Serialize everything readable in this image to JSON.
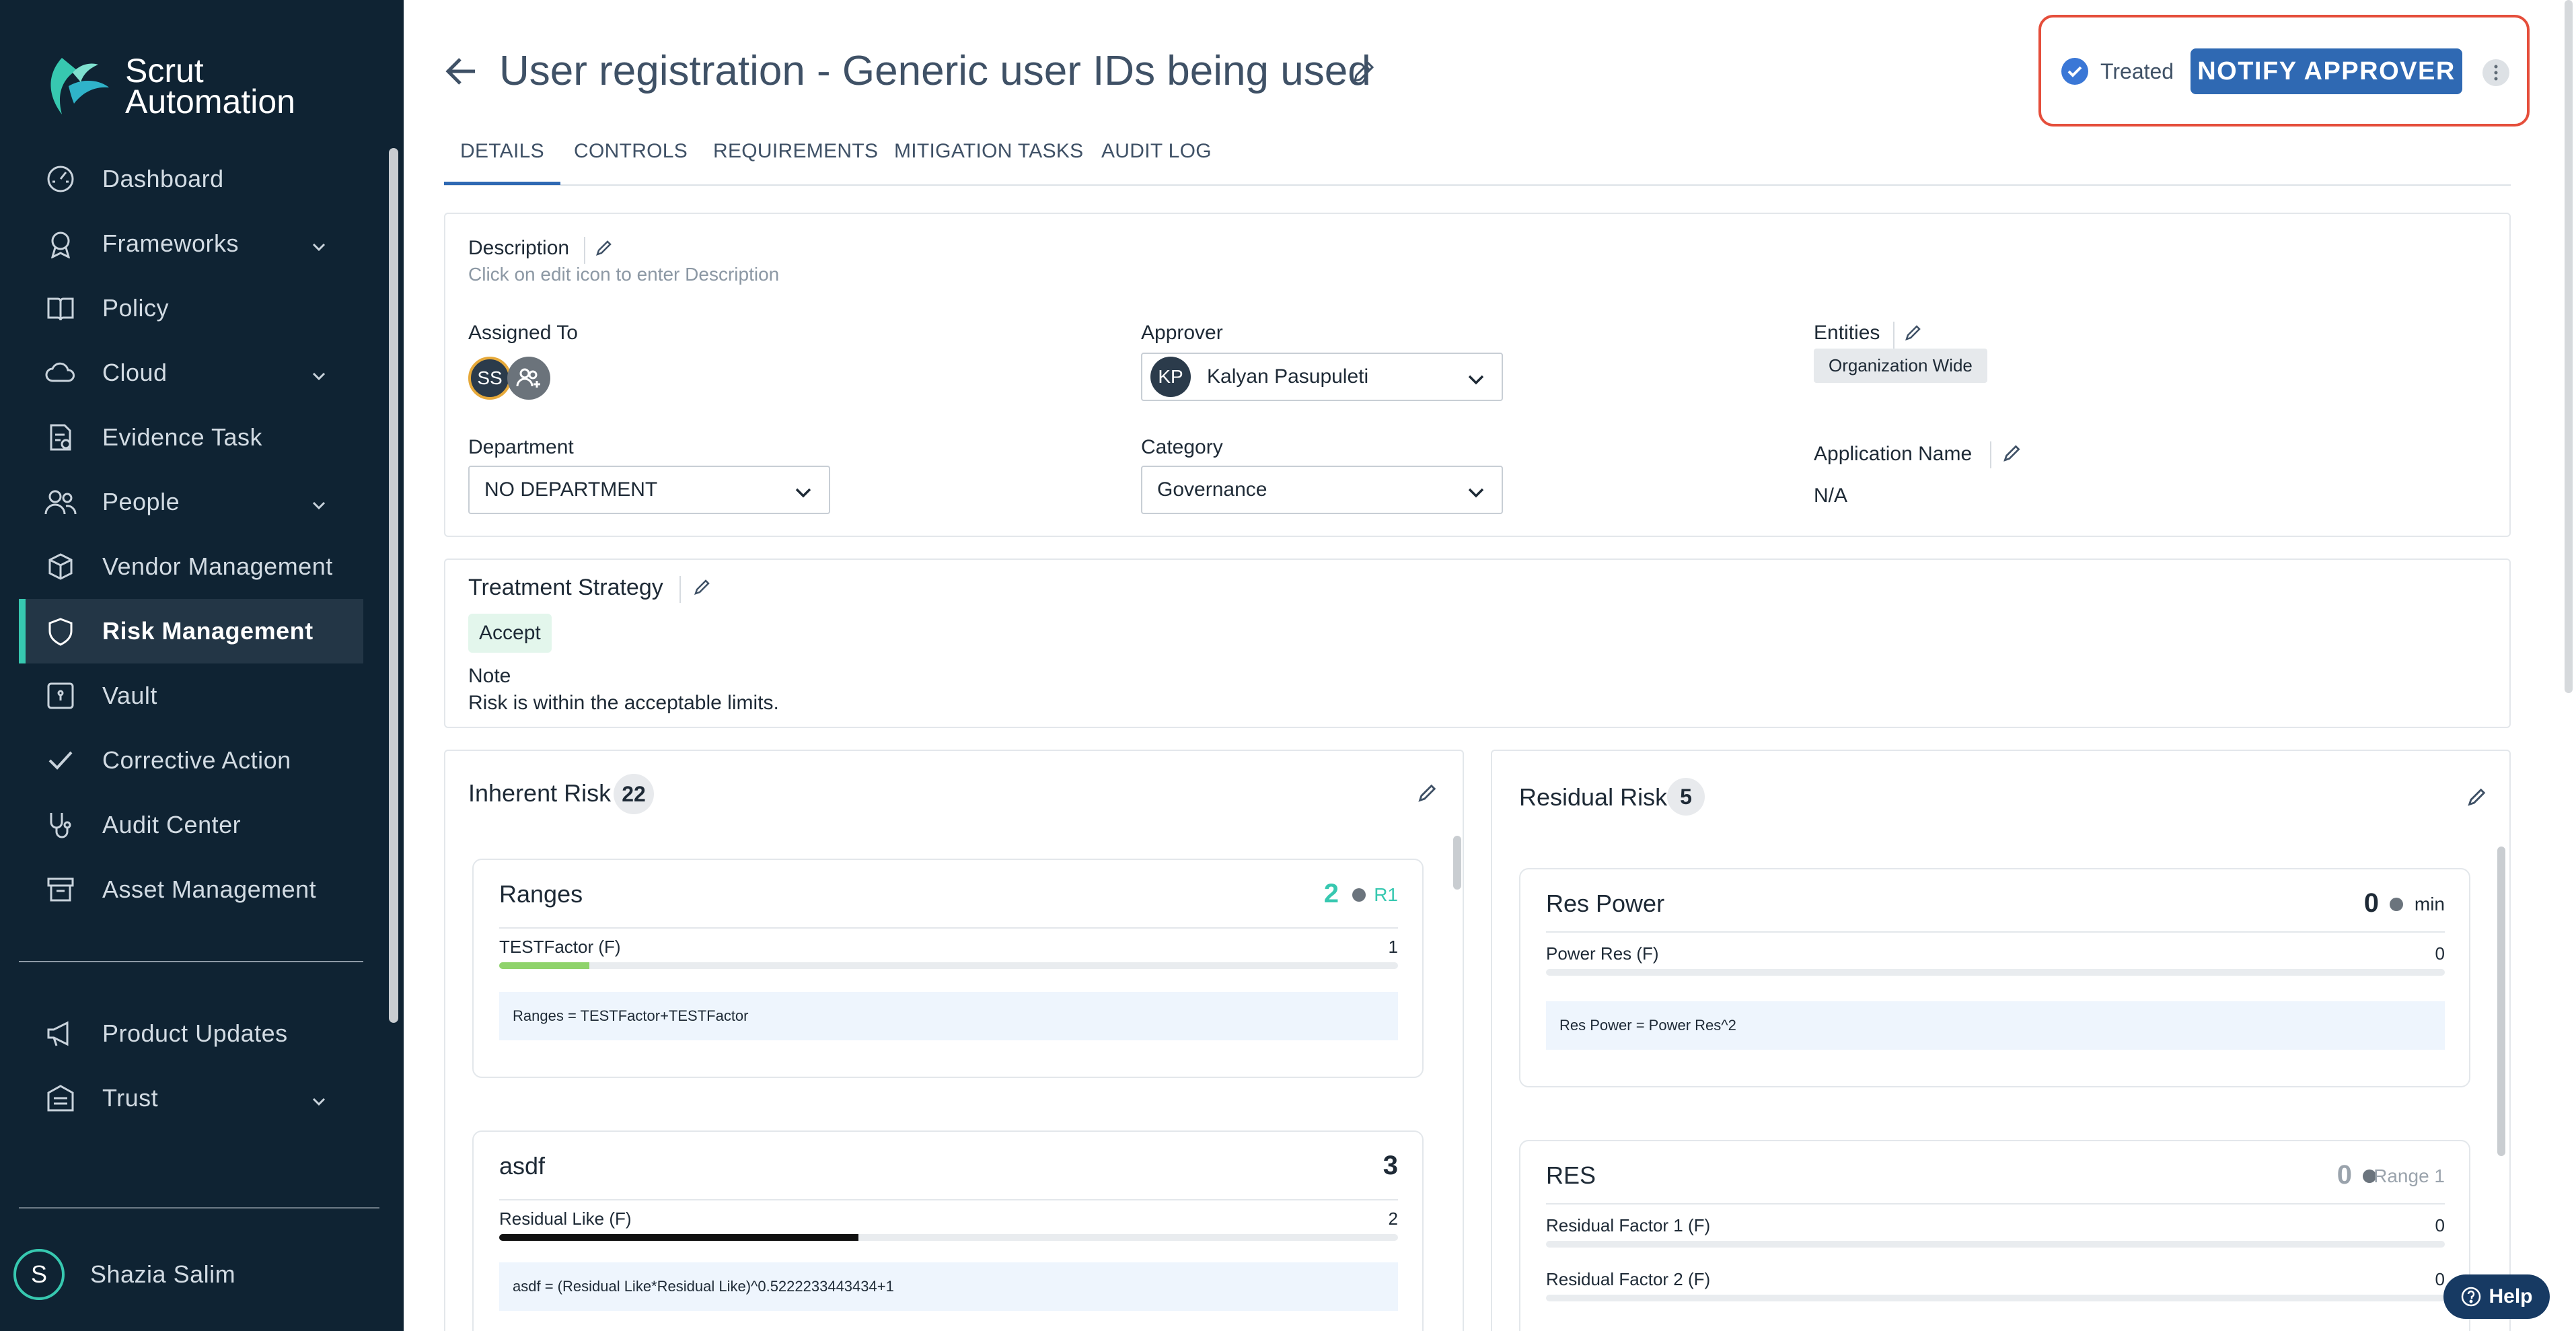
{
  "brand": {
    "line1": "Scrut",
    "line2": "Automation",
    "accent": "#37c8b0"
  },
  "sidebar": {
    "items": [
      {
        "label": "Dashboard",
        "icon": "dashboard-gauge-icon",
        "expandable": false,
        "active": false
      },
      {
        "label": "Frameworks",
        "icon": "frameworks-badge-icon",
        "expandable": true,
        "active": false
      },
      {
        "label": "Policy",
        "icon": "policy-book-icon",
        "expandable": false,
        "active": false
      },
      {
        "label": "Cloud",
        "icon": "cloud-icon",
        "expandable": true,
        "active": false
      },
      {
        "label": "Evidence Task",
        "icon": "evidence-task-icon",
        "expandable": false,
        "active": false
      },
      {
        "label": "People",
        "icon": "people-icon",
        "expandable": true,
        "active": false
      },
      {
        "label": "Vendor Management",
        "icon": "vendor-cube-icon",
        "expandable": false,
        "active": false
      },
      {
        "label": "Risk Management",
        "icon": "shield-icon",
        "expandable": false,
        "active": true
      },
      {
        "label": "Vault",
        "icon": "vault-icon",
        "expandable": false,
        "active": false
      },
      {
        "label": "Corrective Action",
        "icon": "check-icon",
        "expandable": false,
        "active": false
      },
      {
        "label": "Audit Center",
        "icon": "stethoscope-icon",
        "expandable": false,
        "active": false
      },
      {
        "label": "Asset Management",
        "icon": "archive-box-icon",
        "expandable": false,
        "active": false
      }
    ],
    "secondary": [
      {
        "label": "Product Updates",
        "icon": "megaphone-icon",
        "expandable": false
      },
      {
        "label": "Trust",
        "icon": "trust-building-icon",
        "expandable": true
      }
    ],
    "user": {
      "initial": "S",
      "name": "Shazia Salim"
    }
  },
  "header": {
    "title": "User registration - Generic user IDs being used",
    "status": "Treated",
    "notify_label": "NOTIFY APPROVER"
  },
  "tabs": [
    "DETAILS",
    "CONTROLS",
    "REQUIREMENTS",
    "MITIGATION TASKS",
    "AUDIT LOG"
  ],
  "details": {
    "description_label": "Description",
    "description_placeholder": "Click on edit icon to enter Description",
    "assigned_label": "Assigned To",
    "assigned_initials": "SS",
    "approver_label": "Approver",
    "approver_initials": "KP",
    "approver_name": "Kalyan Pasupuleti",
    "entities_label": "Entities",
    "entities_chip": "Organization Wide",
    "department_label": "Department",
    "department_value": "NO DEPARTMENT",
    "category_label": "Category",
    "category_value": "Governance",
    "app_name_label": "Application Name",
    "app_name_value": "N/A"
  },
  "treatment": {
    "title": "Treatment Strategy",
    "strategy": "Accept",
    "note_label": "Note",
    "note": "Risk is within the acceptable limits."
  },
  "inherent": {
    "title": "Inherent Risk",
    "score": "22",
    "cards": [
      {
        "title": "Ranges",
        "score": "2",
        "level": "R1",
        "score_color": "#37c8b0",
        "factor": "TESTFactor (F)",
        "factor_value": "1",
        "fill": 0.1,
        "fill_color": "#8fd36b",
        "formula": "Ranges = TESTFactor+TESTFactor"
      },
      {
        "title": "asdf",
        "score": "3",
        "level": "",
        "score_color": "#1e2a36",
        "factor": "Residual Like (F)",
        "factor_value": "2",
        "fill": 0.4,
        "fill_color": "#111111",
        "formula": "asdf = (Residual Like*Residual Like)^0.5222233443434+1"
      }
    ]
  },
  "residual": {
    "title": "Residual Risk",
    "score": "5",
    "cards": [
      {
        "title": "Res Power",
        "score": "0",
        "level": "min",
        "score_color": "#1e2a36",
        "factor": "Power Res (F)",
        "factor_value": "0",
        "formula": "Res Power = Power Res^2"
      },
      {
        "title": "RES",
        "score": "0",
        "level": "Range 1",
        "score_color": "#9aa3ac",
        "factors": [
          {
            "name": "Residual Factor 1 (F)",
            "value": "0"
          },
          {
            "name": "Residual Factor 2 (F)",
            "value": "0"
          }
        ]
      }
    ]
  },
  "help_label": "Help"
}
